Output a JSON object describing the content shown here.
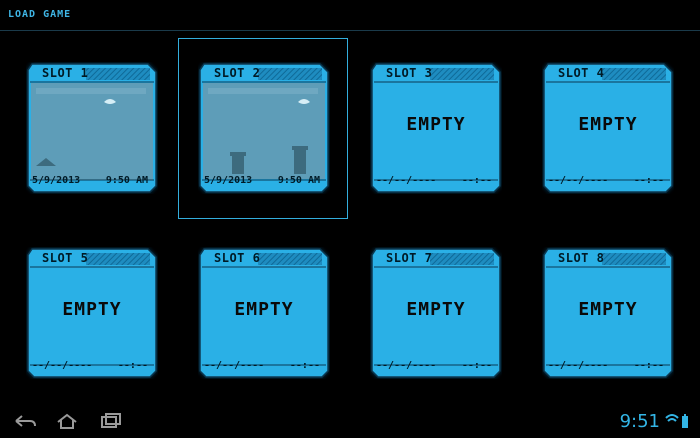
{
  "header": {
    "title": "LOAD GAME"
  },
  "slots": [
    {
      "label": "SLOT 1",
      "status": "",
      "date": "5/9/2013",
      "time": "9:50 AM",
      "thumbnail": "mario-world-1-1"
    },
    {
      "label": "SLOT 2",
      "status": "",
      "date": "5/9/2013",
      "time": "9:50 AM",
      "thumbnail": "mario-pipes"
    },
    {
      "label": "SLOT 3",
      "status": "EMPTY",
      "date": "--/--/----",
      "time": "--:--"
    },
    {
      "label": "SLOT 4",
      "status": "EMPTY",
      "date": "--/--/----",
      "time": "--:--"
    },
    {
      "label": "SLOT 5",
      "status": "EMPTY",
      "date": "--/--/----",
      "time": "--:--"
    },
    {
      "label": "SLOT 6",
      "status": "EMPTY",
      "date": "--/--/----",
      "time": "--:--"
    },
    {
      "label": "SLOT 7",
      "status": "EMPTY",
      "date": "--/--/----",
      "time": "--:--"
    },
    {
      "label": "SLOT 8",
      "status": "EMPTY",
      "date": "--/--/----",
      "time": "--:--"
    }
  ],
  "selected_slot": "SLOT 2",
  "navbar": {
    "icons": [
      "back-icon",
      "home-icon",
      "recent-apps-icon"
    ],
    "clock": "9:51"
  },
  "colors": {
    "accent": "#33b5e5",
    "card": "#2ab0e6",
    "background": "#000000"
  }
}
